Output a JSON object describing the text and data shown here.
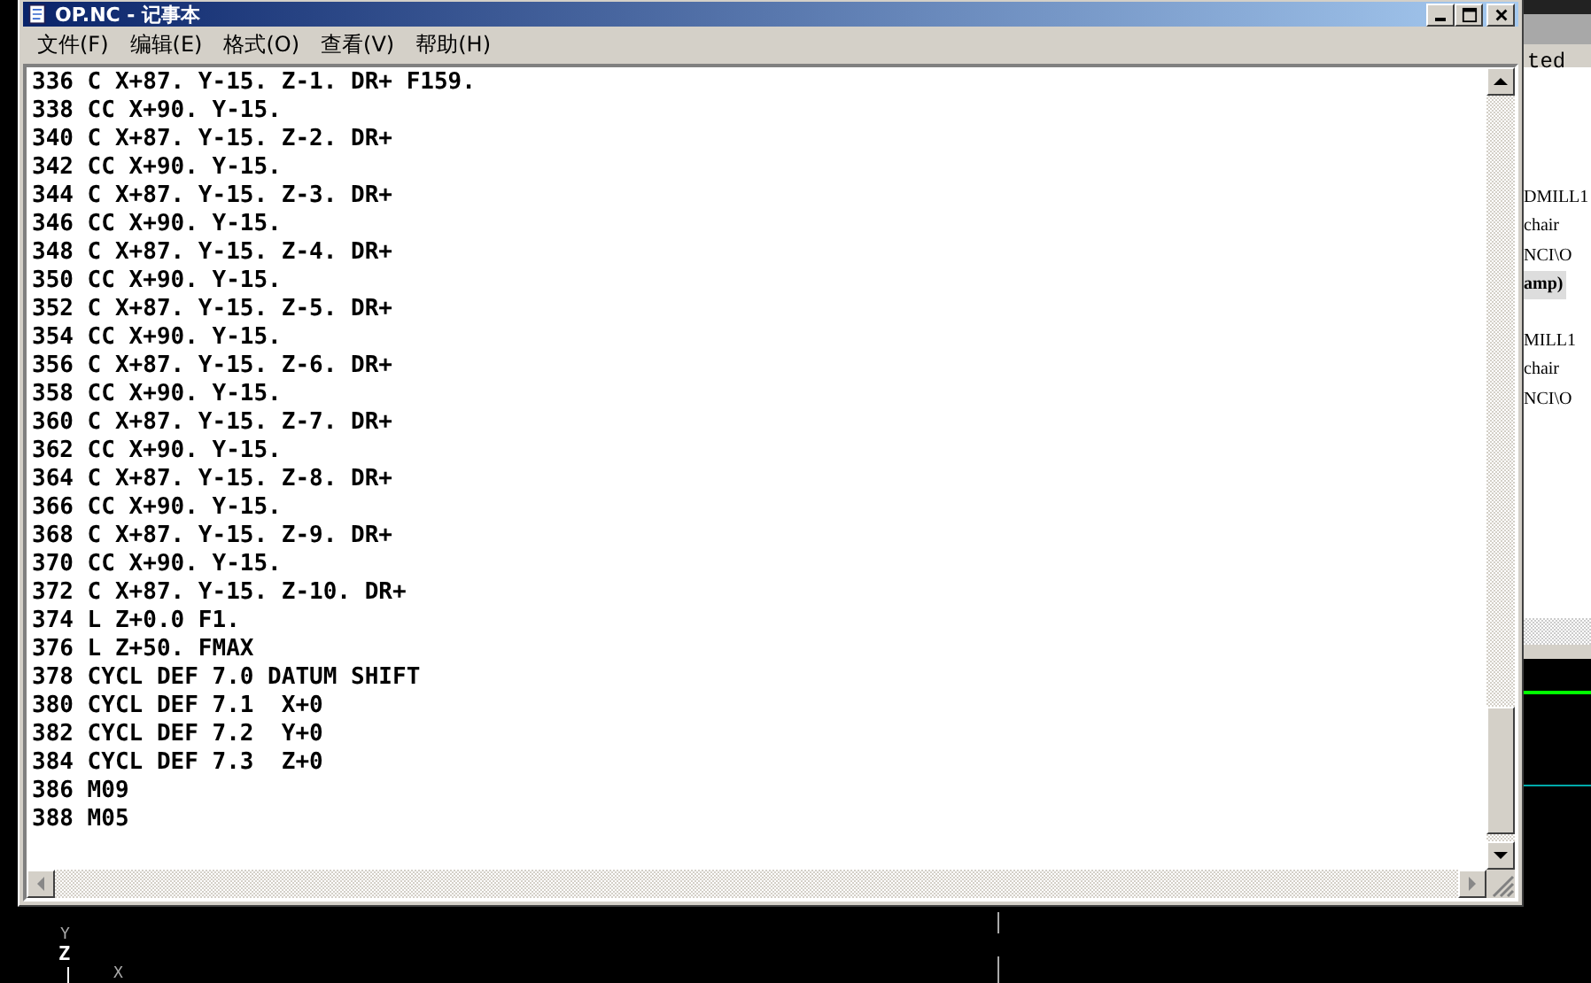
{
  "window": {
    "title": "OP.NC - 记事本"
  },
  "menu": [
    "文件(F)",
    "编辑(E)",
    "格式(O)",
    "查看(V)",
    "帮助(H)"
  ],
  "lines": [
    "336 C X+87. Y-15. Z-1. DR+ F159.",
    "338 CC X+90. Y-15.",
    "340 C X+87. Y-15. Z-2. DR+",
    "342 CC X+90. Y-15.",
    "344 C X+87. Y-15. Z-3. DR+",
    "346 CC X+90. Y-15.",
    "348 C X+87. Y-15. Z-4. DR+",
    "350 CC X+90. Y-15.",
    "352 C X+87. Y-15. Z-5. DR+",
    "354 CC X+90. Y-15.",
    "356 C X+87. Y-15. Z-6. DR+",
    "358 CC X+90. Y-15.",
    "360 C X+87. Y-15. Z-7. DR+",
    "362 CC X+90. Y-15.",
    "364 C X+87. Y-15. Z-8. DR+",
    "366 CC X+90. Y-15.",
    "368 C X+87. Y-15. Z-9. DR+",
    "370 CC X+90. Y-15.",
    "372 C X+87. Y-15. Z-10. DR+",
    "374 L Z+0.0 F1.",
    "376 L Z+50. FMAX",
    "378 CYCL DEF 7.0 DATUM SHIFT",
    "380 CYCL DEF 7.1  X+0",
    "382 CYCL DEF 7.2  Y+0",
    "384 CYCL DEF 7.3  Z+0",
    "386 M09",
    "388 M05"
  ],
  "back_window": {
    "header": "ted",
    "groups": [
      [
        {
          "text": "DMILL1",
          "bold": false
        },
        {
          "text": "chair",
          "bold": false
        },
        {
          "text": "NCI\\O",
          "bold": false
        },
        {
          "text": "amp)",
          "bold": true
        }
      ],
      [
        {
          "text": "MILL1",
          "bold": false
        },
        {
          "text": "chair",
          "bold": false
        },
        {
          "text": "NCI\\O",
          "bold": false
        }
      ]
    ]
  },
  "axes": {
    "y": "Y",
    "z": "Z",
    "x": "X"
  }
}
